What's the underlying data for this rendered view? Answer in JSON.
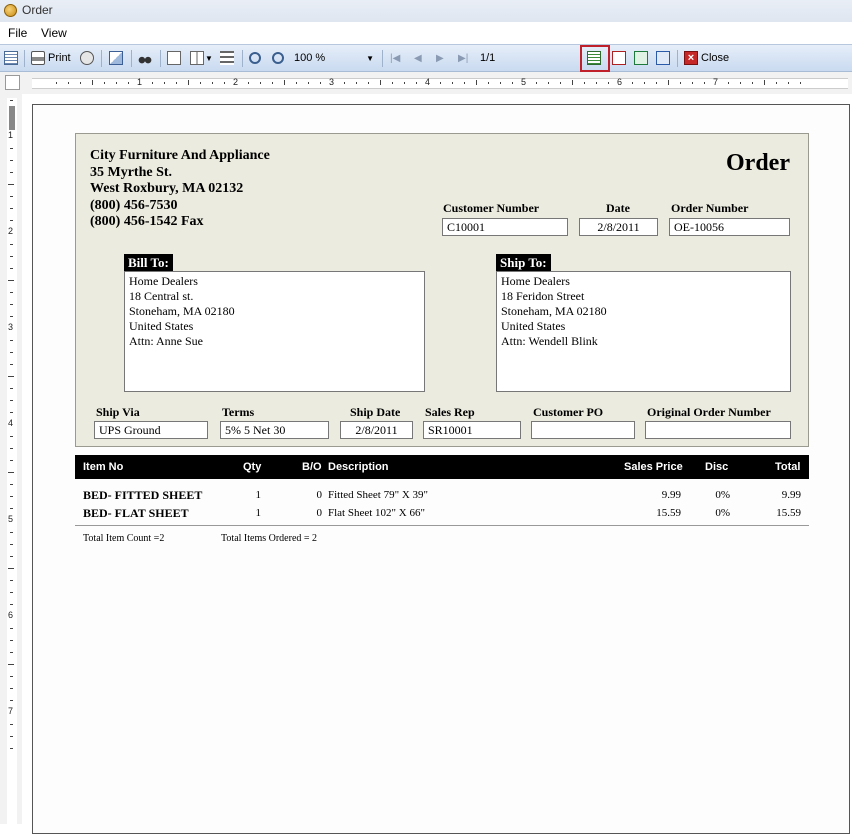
{
  "window": {
    "title": "Order"
  },
  "menu": {
    "file": "File",
    "view": "View"
  },
  "toolbar": {
    "print_label": "Print",
    "zoom": "100 %",
    "page_indicator": "1/1",
    "close_label": "Close"
  },
  "ruler": {
    "marks": [
      "1",
      "2",
      "3",
      "4",
      "5",
      "6",
      "7"
    ]
  },
  "company": {
    "name": "City Furniture And Appliance",
    "street": "35 Myrthe St.",
    "city": "West Roxbury, MA 02132",
    "phone": "(800) 456-7530",
    "fax": "(800) 456-1542 Fax"
  },
  "document": {
    "title": "Order"
  },
  "fields": {
    "customer_number_label": "Customer Number",
    "customer_number": "C10001",
    "date_label": "Date",
    "date": "2/8/2011",
    "order_number_label": "Order Number",
    "order_number": "OE-10056",
    "ship_via_label": "Ship Via",
    "ship_via": "UPS Ground",
    "terms_label": "Terms",
    "terms": "5% 5 Net 30",
    "ship_date_label": "Ship Date",
    "ship_date": "2/8/2011",
    "sales_rep_label": "Sales Rep",
    "sales_rep": "SR10001",
    "customer_po_label": "Customer PO",
    "customer_po": "",
    "original_order_label": "Original Order Number",
    "original_order": ""
  },
  "bill_to": {
    "label": "Bill To:",
    "lines": [
      "Home Dealers",
      "18 Central st.",
      "Stoneham, MA 02180",
      "United States",
      "Attn: Anne Sue"
    ]
  },
  "ship_to": {
    "label": "Ship To:",
    "lines": [
      "Home Dealers",
      "18 Feridon Street",
      "Stoneham, MA 02180",
      "United States",
      "Attn: Wendell Blink"
    ]
  },
  "table": {
    "headers": {
      "item": "Item No",
      "qty": "Qty",
      "bo": "B/O",
      "desc": "Description",
      "price": "Sales Price",
      "disc": "Disc",
      "total": "Total"
    },
    "rows": [
      {
        "item": "BED- FITTED SHEET",
        "qty": "1",
        "bo": "0",
        "desc": "Fitted Sheet 79\" X 39\"",
        "price": "9.99",
        "disc": "0%",
        "total": "9.99"
      },
      {
        "item": "BED- FLAT SHEET",
        "qty": "1",
        "bo": "0",
        "desc": "Flat Sheet 102\" X 66\"",
        "price": "15.59",
        "disc": "0%",
        "total": "15.59"
      }
    ]
  },
  "totals": {
    "item_count": "Total Item Count =2",
    "items_ordered": "Total Items Ordered =  2"
  }
}
